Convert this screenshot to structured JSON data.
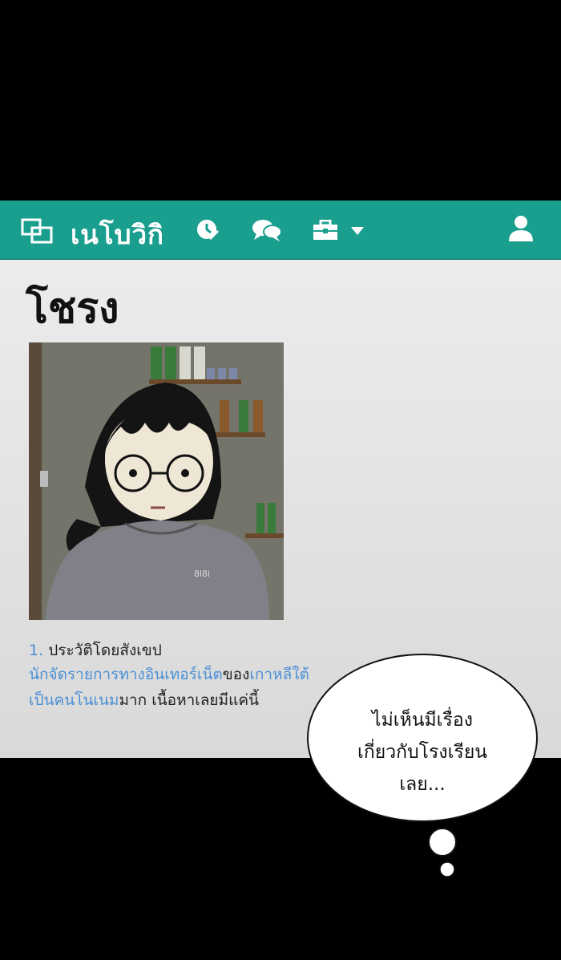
{
  "navbar": {
    "logo_text": "เนโบวิกิ",
    "icons": [
      "logo-icon",
      "history-icon",
      "discussion-icon",
      "toolbox-icon",
      "chevron-down-icon",
      "user-icon"
    ]
  },
  "page": {
    "title": "โชรง"
  },
  "section": {
    "number": "1.",
    "heading": "ประวัติโดยสังเขป"
  },
  "body": {
    "line1_link1": "นักจัดรายการทางอินเทอร์เน็ต",
    "line1_text": "ของ",
    "line1_link2": "เกาหลีใต้",
    "line2_link": "เป็นคนโนเนม",
    "line2_text": "มาก เนื้อหาเลยมีแค่นี้"
  },
  "speech_bubble": {
    "line1": "ไม่เห็นมีเรื่อง",
    "line2": "เกี่ยวกับโรงเรียน",
    "line3": "เลย..."
  },
  "colors": {
    "navbar": "#1a9f8f",
    "link": "#4a8fd6",
    "background": "#000000"
  }
}
